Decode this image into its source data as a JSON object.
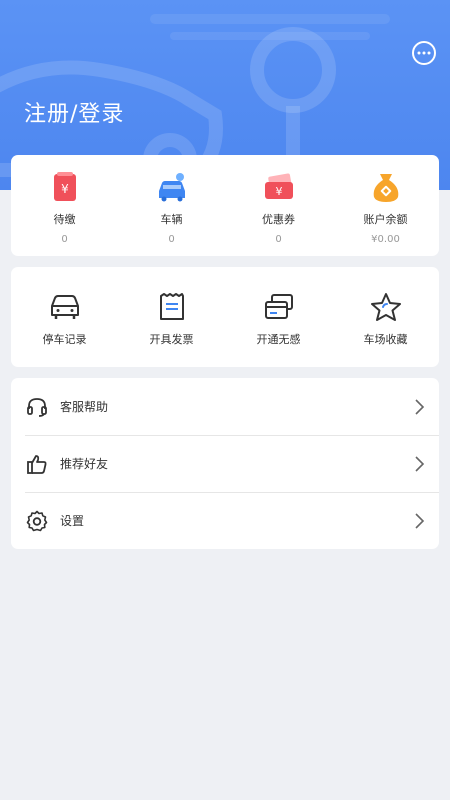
{
  "header": {
    "login_label": "注册/登录",
    "message_icon": "chat-bubble-icon",
    "bg_color": "#5b93f5"
  },
  "stats": [
    {
      "label": "待缴",
      "value": "0",
      "icon": "pending-payment-icon"
    },
    {
      "label": "车辆",
      "value": "0",
      "icon": "vehicle-icon"
    },
    {
      "label": "优惠券",
      "value": "0",
      "icon": "coupon-icon"
    },
    {
      "label": "账户余额",
      "value": "¥0.00",
      "icon": "money-bag-icon"
    }
  ],
  "functions": [
    {
      "label": "停车记录",
      "icon": "car-icon"
    },
    {
      "label": "开具发票",
      "icon": "receipt-icon"
    },
    {
      "label": "开通无感",
      "icon": "cards-icon"
    },
    {
      "label": "车场收藏",
      "icon": "star-icon"
    }
  ],
  "menu": [
    {
      "label": "客服帮助",
      "icon": "headset-icon"
    },
    {
      "label": "推荐好友",
      "icon": "thumbs-up-icon"
    },
    {
      "label": "设置",
      "icon": "gear-icon"
    }
  ],
  "colors": {
    "accent": "#4d86ef",
    "page_bg": "#eef0f4",
    "icon_red": "#f0505a",
    "icon_blue": "#3f86f2",
    "icon_orange": "#f7a52b"
  }
}
